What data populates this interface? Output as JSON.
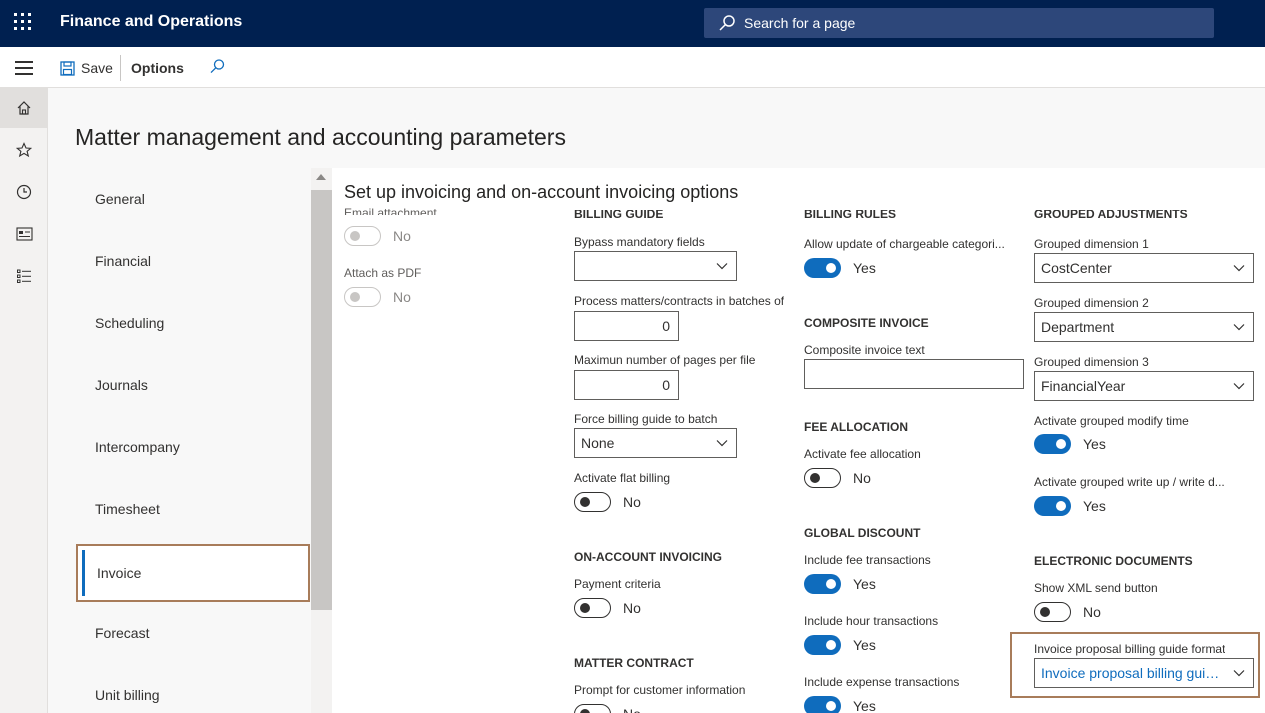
{
  "app": {
    "title": "Finance and Operations"
  },
  "search": {
    "placeholder": "Search for a page"
  },
  "toolbar": {
    "save_label": "Save",
    "options_label": "Options"
  },
  "page": {
    "title": "Matter management and accounting parameters",
    "section_title": "Set up invoicing and on-account invoicing options"
  },
  "tabs": [
    "General",
    "Financial",
    "Scheduling",
    "Journals",
    "Intercompany",
    "Timesheet",
    "Invoice",
    "Forecast",
    "Unit billing"
  ],
  "selected_tab": "Invoice",
  "col0": {
    "cut_label": "Email attachment",
    "email_attachment_value": "No",
    "attach_pdf_label": "Attach as PDF",
    "attach_pdf_value": "No"
  },
  "col1": {
    "billing_guide_header": "BILLING GUIDE",
    "bypass_label": "Bypass mandatory fields",
    "bypass_value": "",
    "batches_label": "Process matters/contracts in batches of",
    "batches_value": "0",
    "max_pages_label": "Maximun number of pages per file",
    "max_pages_value": "0",
    "force_batch_label": "Force billing guide to batch",
    "force_batch_value": "None",
    "flat_billing_label": "Activate flat billing",
    "flat_billing_value": "No",
    "on_account_header": "ON-ACCOUNT INVOICING",
    "payment_criteria_label": "Payment criteria",
    "payment_criteria_value": "No",
    "matter_contract_header": "MATTER CONTRACT",
    "prompt_customer_label": "Prompt for customer information",
    "prompt_customer_value": "No"
  },
  "col2": {
    "billing_rules_header": "BILLING RULES",
    "allow_update_label": "Allow update of chargeable categori...",
    "allow_update_value": "Yes",
    "composite_header": "COMPOSITE INVOICE",
    "composite_text_label": "Composite invoice text",
    "composite_text_value": "",
    "fee_allocation_header": "FEE ALLOCATION",
    "activate_fee_label": "Activate fee allocation",
    "activate_fee_value": "No",
    "global_discount_header": "GLOBAL DISCOUNT",
    "fee_tx_label": "Include fee transactions",
    "fee_tx_value": "Yes",
    "hour_tx_label": "Include hour transactions",
    "hour_tx_value": "Yes",
    "expense_tx_label": "Include expense transactions",
    "expense_tx_value": "Yes"
  },
  "col3": {
    "grouped_header": "GROUPED ADJUSTMENTS",
    "dim1_label": "Grouped dimension 1",
    "dim1_value": "CostCenter",
    "dim2_label": "Grouped dimension 2",
    "dim2_value": "Department",
    "dim3_label": "Grouped dimension 3",
    "dim3_value": "FinancialYear",
    "modify_time_label": "Activate grouped modify time",
    "modify_time_value": "Yes",
    "write_up_label": "Activate grouped write up / write d...",
    "write_up_value": "Yes",
    "edocs_header": "ELECTRONIC DOCUMENTS",
    "xml_send_label": "Show XML send button",
    "xml_send_value": "No",
    "proposal_format_label": "Invoice proposal billing guide format",
    "proposal_format_value": "Invoice proposal billing guide..."
  },
  "colors": {
    "topbar": "#002050",
    "accent": "#0f6cbd",
    "highlight": "#a87c5a"
  },
  "icons": [
    "waffle-icon",
    "search-icon",
    "hamburger-icon",
    "save-icon",
    "find-icon",
    "home-icon",
    "star-icon",
    "clock-icon",
    "workspace-icon",
    "list-icon",
    "chevron-down-icon"
  ]
}
